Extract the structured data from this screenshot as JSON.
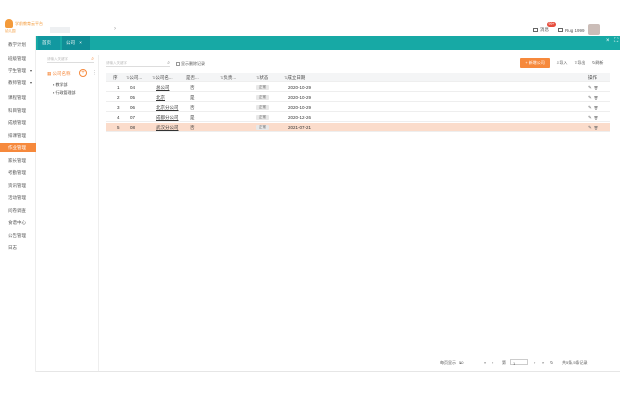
{
  "header": {
    "logo_text": "学前教育云平台",
    "logo_sub": "幼儿园",
    "messages_label": "消息",
    "messages_badge": "99+",
    "user_label": "Rug 1999"
  },
  "sidebar": {
    "items": [
      {
        "label": "教学计划"
      },
      {
        "label": "班级管理"
      },
      {
        "label": "学生管理",
        "caret": "▾"
      },
      {
        "label": "教师管理",
        "caret": "▾"
      },
      {
        "label": "课程管理"
      },
      {
        "label": "科目管理"
      },
      {
        "label": "成绩管理"
      },
      {
        "label": "排课管理"
      },
      {
        "label": "作业管理"
      },
      {
        "label": "家长管理"
      },
      {
        "label": "考勤管理"
      },
      {
        "label": "资讯管理"
      },
      {
        "label": "活动管理"
      },
      {
        "label": "问卷调查"
      },
      {
        "label": "食谱中心"
      },
      {
        "label": "公告管理"
      },
      {
        "label": "日志"
      }
    ],
    "active_index": 8
  },
  "tabs": {
    "home": "首页",
    "current": "公司",
    "current_close": "×"
  },
  "tree": {
    "search_placeholder": "请输入关键字",
    "root_label": "公司名称",
    "add_symbol": "+",
    "leaves": [
      {
        "label": "教学部"
      },
      {
        "label": "行政管理部"
      }
    ]
  },
  "toolbar": {
    "search_placeholder": "请输入关键字",
    "show_deleted": "显示删除记录",
    "add_button": "+ 新增公司",
    "link_import": "导入",
    "link_export": "导出",
    "link_refresh": "刷新"
  },
  "table": {
    "headers": {
      "index": "序",
      "code": "公司...",
      "name": "公司名...",
      "type": "是否...",
      "contact": "负责...",
      "status": "状态",
      "date": "成立日期",
      "actions": "操作"
    },
    "rows": [
      {
        "index": "1",
        "code": "04",
        "name": "总公司",
        "type": "否",
        "contact": "",
        "status": "正常",
        "date": "2020-10-29",
        "selected": false
      },
      {
        "index": "2",
        "code": "05",
        "name": "北京",
        "type": "是",
        "contact": "",
        "status": "正常",
        "date": "2020-10-29",
        "selected": false
      },
      {
        "index": "3",
        "code": "06",
        "name": "北京分公司",
        "type": "否",
        "contact": "",
        "status": "正常",
        "date": "2020-10-29",
        "selected": false
      },
      {
        "index": "4",
        "code": "07",
        "name": "成都分公司",
        "type": "是",
        "contact": "",
        "status": "正常",
        "date": "2020-12-26",
        "selected": false
      },
      {
        "index": "5",
        "code": "08",
        "name": "武汉分公司",
        "type": "否",
        "contact": "",
        "status": "正常",
        "date": "2021-07-21",
        "selected": true
      }
    ],
    "action_edit": "✎",
    "action_delete": "🗑"
  },
  "pager": {
    "per_page_label": "每页显示",
    "per_page_value": "50",
    "page_prefix": "第",
    "page_value": "1",
    "page_suffix": "共1页",
    "summary": "共5条,5条记录"
  }
}
